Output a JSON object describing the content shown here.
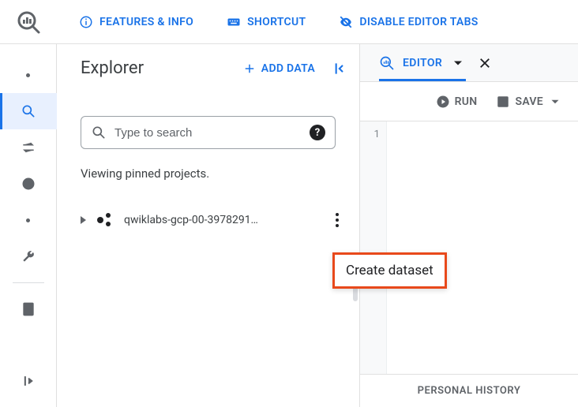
{
  "header": {
    "features": "FEATURES & INFO",
    "shortcut": "SHORTCUT",
    "disable_tabs": "DISABLE EDITOR TABS"
  },
  "explorer": {
    "title": "Explorer",
    "add_data": "ADD DATA",
    "search_placeholder": "Type to search",
    "viewing": "Viewing pinned projects.",
    "project_name": "qwiklabs-gcp-00-3978291…"
  },
  "popover": {
    "create_dataset": "Create dataset"
  },
  "editor": {
    "tab_label": "EDITOR",
    "run": "RUN",
    "save": "SAVE",
    "line1": "1",
    "footer": "PERSONAL HISTORY"
  },
  "colors": {
    "accent": "#1a73e8",
    "highlight": "#e8491b"
  }
}
